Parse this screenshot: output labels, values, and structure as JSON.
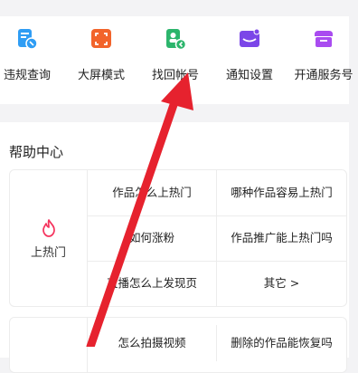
{
  "shortcuts": [
    {
      "label": "违规查询",
      "icon": "violation-query-icon",
      "color": "#2f9df4"
    },
    {
      "label": "大屏模式",
      "icon": "big-screen-icon",
      "color": "#f2642b"
    },
    {
      "label": "找回帐号",
      "icon": "recover-account-icon",
      "color": "#2cb56c"
    },
    {
      "label": "通知设置",
      "icon": "notification-icon",
      "color": "#7b46e8"
    },
    {
      "label": "开通服务号",
      "icon": "service-account-icon",
      "color": "#a94cf0"
    }
  ],
  "help": {
    "title": "帮助中心",
    "sections": [
      {
        "label": "上热门",
        "icon": "flame-icon",
        "accent": "#f5325c",
        "items": [
          [
            "作品怎么上热门",
            "哪种作品容易上热门"
          ],
          [
            "如何涨粉",
            "作品推广能上热门吗"
          ],
          [
            "直播怎么上发现页",
            "其它 >"
          ]
        ]
      },
      {
        "items": [
          [
            "怎么拍摄视频",
            "删除的作品能恢复吗"
          ]
        ]
      }
    ]
  },
  "overlay_color": "#e6222e"
}
